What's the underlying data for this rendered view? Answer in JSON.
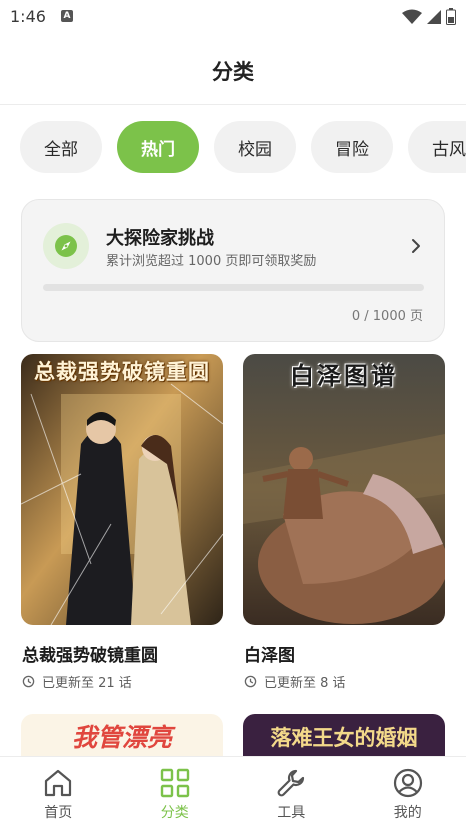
{
  "status_bar": {
    "time": "1:46",
    "notification_badge": "A"
  },
  "header": {
    "title": "分类"
  },
  "categories": [
    {
      "label": "全部",
      "active": false
    },
    {
      "label": "热门",
      "active": true
    },
    {
      "label": "校园",
      "active": false
    },
    {
      "label": "冒险",
      "active": false
    },
    {
      "label": "古风",
      "active": false
    }
  ],
  "challenge": {
    "title": "大探险家挑战",
    "subtitle": "累计浏览超过 1000 页即可领取奖励",
    "progress_text": "0 / 1000 页",
    "progress": 0,
    "icon": "compass-icon"
  },
  "comics": [
    {
      "cover_text": "总裁强势破镜重圆",
      "title": "总裁强势破镜重圆",
      "update": "已更新至 21 话"
    },
    {
      "cover_text": "白泽图谱",
      "title": "白泽图",
      "update": "已更新至 8 话"
    }
  ],
  "partial_comics": [
    {
      "cover_text": "我管漂亮"
    },
    {
      "cover_text": "落难王女的婚姻"
    }
  ],
  "bottom_nav": [
    {
      "label": "首页",
      "icon": "home-icon",
      "active": false
    },
    {
      "label": "分类",
      "icon": "grid-icon",
      "active": true
    },
    {
      "label": "工具",
      "icon": "wrench-icon",
      "active": false
    },
    {
      "label": "我的",
      "icon": "profile-icon",
      "active": false
    }
  ],
  "colors": {
    "accent": "#7cc24a",
    "chip_bg": "#f1f1f1",
    "card_bg": "#f4f4f4"
  }
}
